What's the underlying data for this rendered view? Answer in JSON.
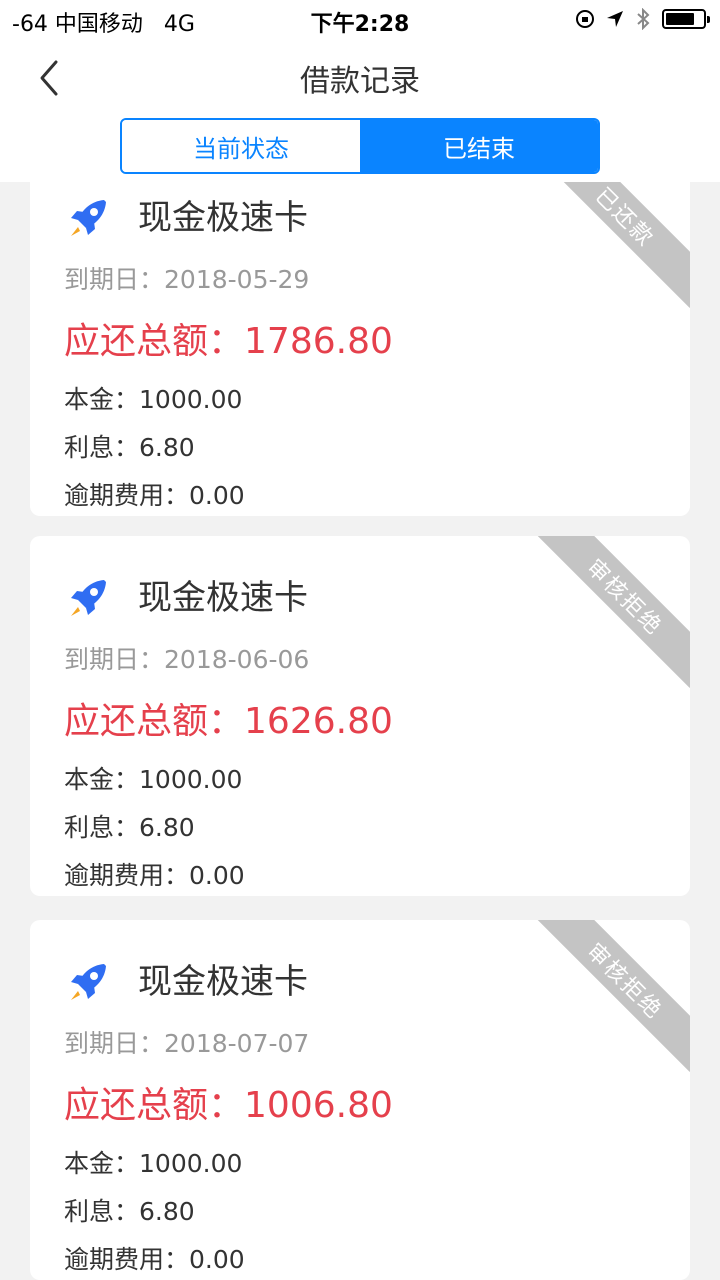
{
  "status_bar": {
    "left": "-64 中国移动   4G",
    "time": "下午2:28"
  },
  "nav": {
    "title": "借款记录"
  },
  "tabs": [
    {
      "label": "当前状态",
      "active": false
    },
    {
      "label": "已结束",
      "active": true
    }
  ],
  "cards": [
    {
      "name": "现金极速卡",
      "due_label": "到期日：",
      "due_date": "2018-05-29",
      "total_label": "应还总额：",
      "total": "1786.80",
      "principal_label": "本金：",
      "principal": "1000.00",
      "interest_label": "利息：",
      "interest": "6.80",
      "overdue_label": "逾期费用：",
      "overdue": "0.00",
      "status": "已还款"
    },
    {
      "name": "现金极速卡",
      "due_label": "到期日：",
      "due_date": "2018-06-06",
      "total_label": "应还总额：",
      "total": "1626.80",
      "principal_label": "本金：",
      "principal": "1000.00",
      "interest_label": "利息：",
      "interest": "6.80",
      "overdue_label": "逾期费用：",
      "overdue": "0.00",
      "status": "审核拒绝"
    },
    {
      "name": "现金极速卡",
      "due_label": "到期日：",
      "due_date": "2018-07-07",
      "total_label": "应还总额：",
      "total": "1006.80",
      "principal_label": "本金：",
      "principal": "1000.00",
      "interest_label": "利息：",
      "interest": "6.80",
      "overdue_label": "逾期费用：",
      "overdue": "0.00",
      "status": "审核拒绝"
    }
  ],
  "colors": {
    "accent": "#0a84ff",
    "amount_red": "#e5404c",
    "ribbon_gray": "#c4c4c4"
  },
  "icons": [
    "back-chevron-icon",
    "lock-rotation-icon",
    "location-arrow-icon",
    "bluetooth-icon",
    "battery-icon",
    "rocket-icon"
  ]
}
